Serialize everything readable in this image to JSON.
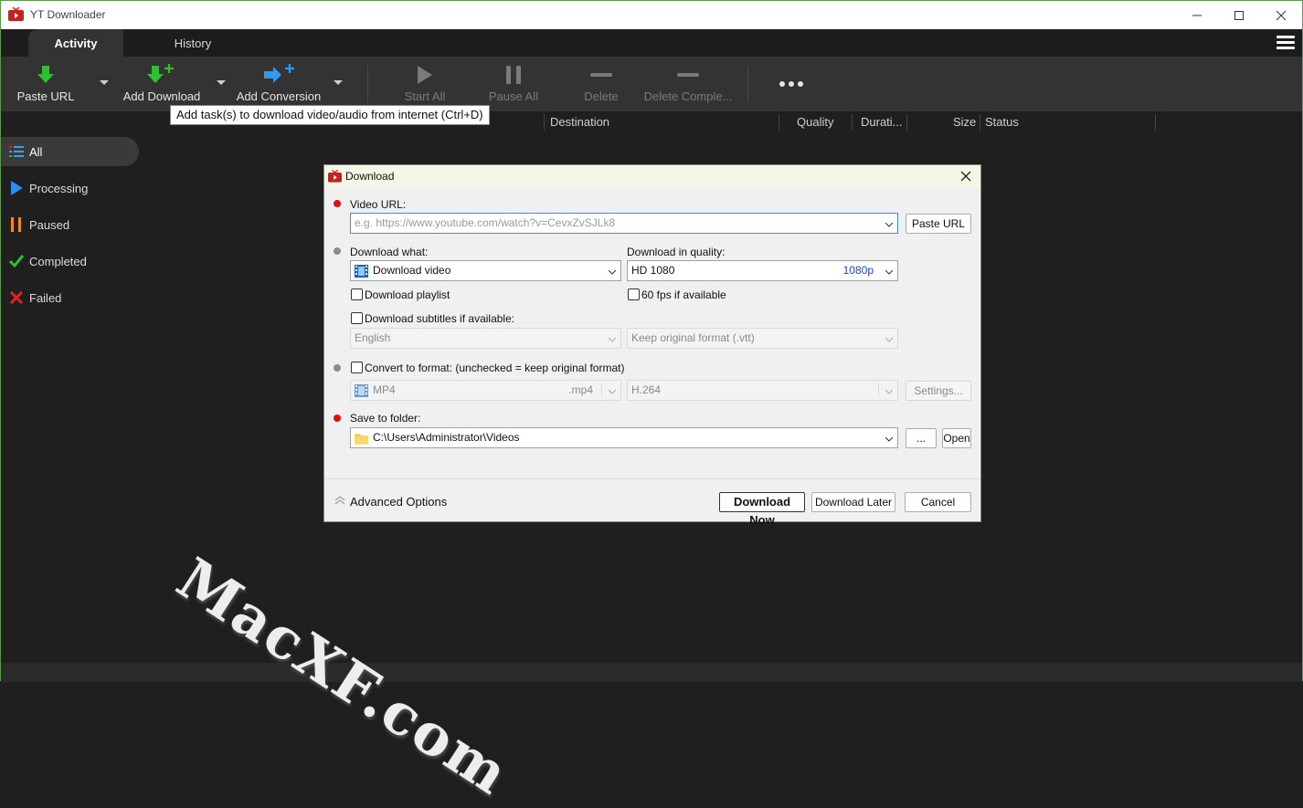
{
  "window": {
    "title": "YT Downloader"
  },
  "tabs": {
    "activity": "Activity",
    "history": "History"
  },
  "toolbar": {
    "paste_url": "Paste URL",
    "add_download": "Add Download",
    "add_conversion": "Add Conversion",
    "start_all": "Start All",
    "pause_all": "Pause All",
    "delete": "Delete",
    "delete_completed": "Delete Comple...",
    "more": "•••"
  },
  "tooltip": "Add task(s) to download video/audio from internet (Ctrl+D)",
  "columns": {
    "destination": "Destination",
    "quality": "Quality",
    "duration": "Durati...",
    "size": "Size",
    "status": "Status"
  },
  "sidebar": {
    "items": [
      {
        "label": "All",
        "icon": "list-icon",
        "color": "#3b9bff"
      },
      {
        "label": "Processing",
        "icon": "play-icon",
        "color": "#2d8cf0"
      },
      {
        "label": "Paused",
        "icon": "pause-icon",
        "color": "#f08a24"
      },
      {
        "label": "Completed",
        "icon": "checkmark-icon",
        "color": "#2fbf2f"
      },
      {
        "label": "Failed",
        "icon": "cross-icon",
        "color": "#e02424"
      }
    ]
  },
  "dialog": {
    "title": "Download",
    "video_url_label": "Video URL:",
    "video_url_placeholder": "e.g. https://www.youtube.com/watch?v=CevxZvSJLk8",
    "paste_url": "Paste URL",
    "download_what_label": "Download what:",
    "download_what_value": "Download video",
    "quality_label": "Download in quality:",
    "quality_value": "HD 1080",
    "quality_tag": "1080p",
    "download_playlist": "Download playlist",
    "fps60": "60 fps if available",
    "subtitles_label": "Download subtitles if available:",
    "subtitle_lang": "English",
    "subtitle_format": "Keep original format (.vtt)",
    "convert_label": "Convert to format: (unchecked = keep original format)",
    "convert_format": "MP4",
    "convert_ext": ".mp4",
    "convert_codec": "H.264",
    "settings": "Settings...",
    "save_folder_label": "Save to folder:",
    "save_folder_value": "C:\\Users\\Administrator\\Videos",
    "browse": "...",
    "open": "Open",
    "advanced": "Advanced Options",
    "download_now": "Download Now",
    "download_later": "Download Later",
    "cancel": "Cancel"
  },
  "watermark": "MacXF.com",
  "colors": {
    "accent_green": "#2fbf2f",
    "accent_blue": "#2d9cf0",
    "required_red": "#e01010"
  }
}
